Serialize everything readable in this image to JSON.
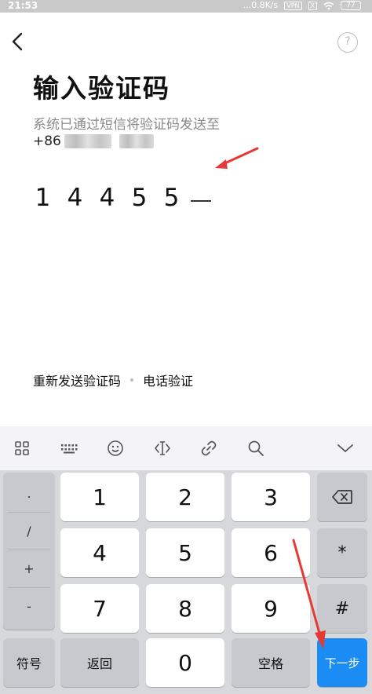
{
  "status_bar": {
    "time": "21:53",
    "net_speed": "...0.8K/s",
    "badge_1": "VPN",
    "badge_2": "X",
    "battery": "77"
  },
  "nav": {
    "back_icon": "chevron-left-icon",
    "help_icon": "question-circle-icon",
    "help_label": "?"
  },
  "page": {
    "title": "输入验证码",
    "subtitle": "系统已通过短信将验证码发送至",
    "phone_prefix": "+86",
    "code_digits": [
      "1",
      "4",
      "4",
      "5",
      "5"
    ]
  },
  "links": {
    "resend": "重新发送验证码",
    "voice": "电话验证"
  },
  "keyboard": {
    "toolbar_icons": [
      "grid-icon",
      "keyboard-icon",
      "emoji-icon",
      "cursor-icon",
      "link-icon",
      "search-icon",
      "collapse-down-icon"
    ],
    "symbols": [
      ".",
      "/",
      "+",
      "-"
    ],
    "digits": [
      "1",
      "2",
      "3",
      "4",
      "5",
      "6",
      "7",
      "8",
      "9",
      "0"
    ],
    "right_keys": [
      "*",
      "#"
    ],
    "delete_icon": "backspace-icon",
    "symbol_label": "符号",
    "return_label": "返回",
    "space_label": "空格",
    "next_label": "下一步"
  },
  "colors": {
    "accent": "#1a8cf3",
    "annotation": "#e53935",
    "keyboard_bg": "#d7d8dc"
  }
}
